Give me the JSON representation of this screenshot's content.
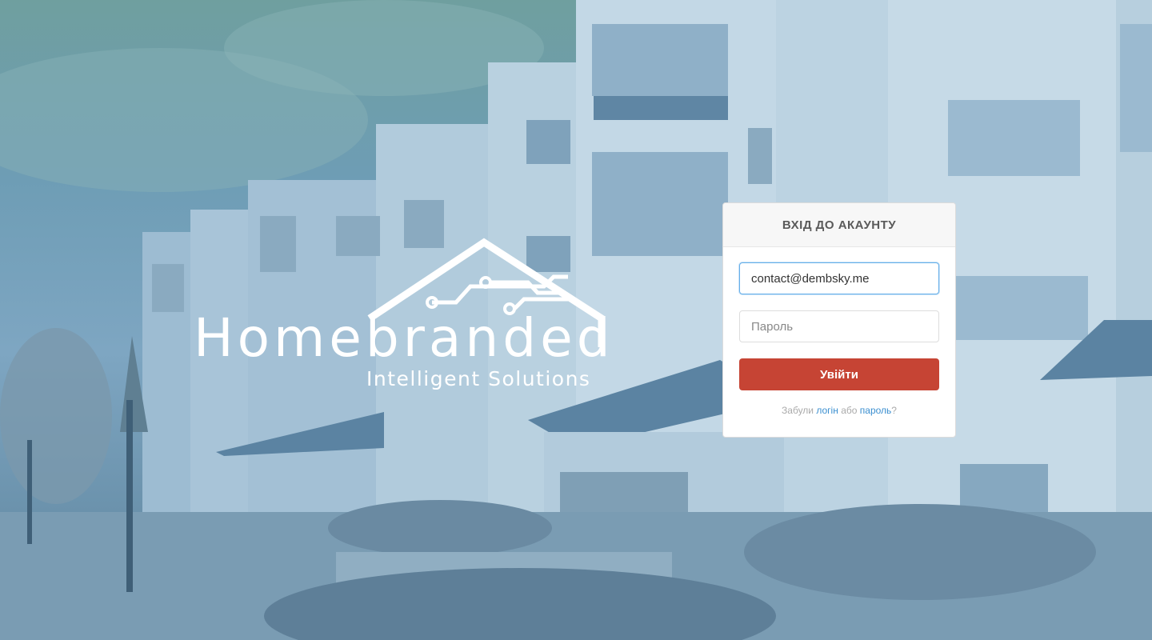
{
  "brand": {
    "title": "Homebranded",
    "subtitle": "Intelligent Solutions"
  },
  "login": {
    "header": "ВХІД ДО АКАУНТУ",
    "email_value": "contact@dembsky.me",
    "password_placeholder": "Пароль",
    "submit_label": "Увійти",
    "forgot_prefix": "Забули",
    "forgot_login_link": "логін",
    "forgot_connector": "або",
    "forgot_password_link": "пароль",
    "forgot_suffix": "?"
  },
  "colors": {
    "overlay": "#6e9db5",
    "submit": "#c64434",
    "link": "#3b8fd0"
  }
}
